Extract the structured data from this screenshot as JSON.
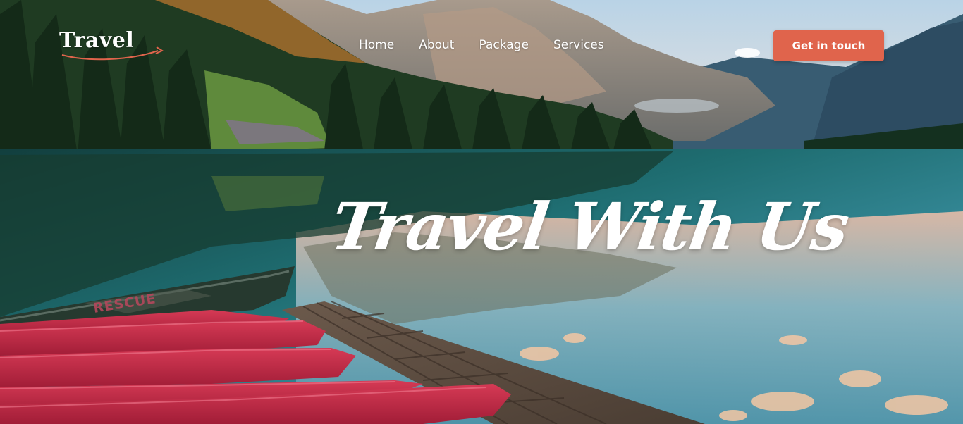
{
  "brand": {
    "logo_text": "Travel",
    "accent_color": "#e0644c"
  },
  "nav": {
    "items": [
      {
        "label": "Home"
      },
      {
        "label": "About"
      },
      {
        "label": "Package"
      },
      {
        "label": "Services"
      }
    ]
  },
  "cta": {
    "label": "Get in touch"
  },
  "hero": {
    "headline": "Travel With Us",
    "boat_text": "RESCUE"
  }
}
